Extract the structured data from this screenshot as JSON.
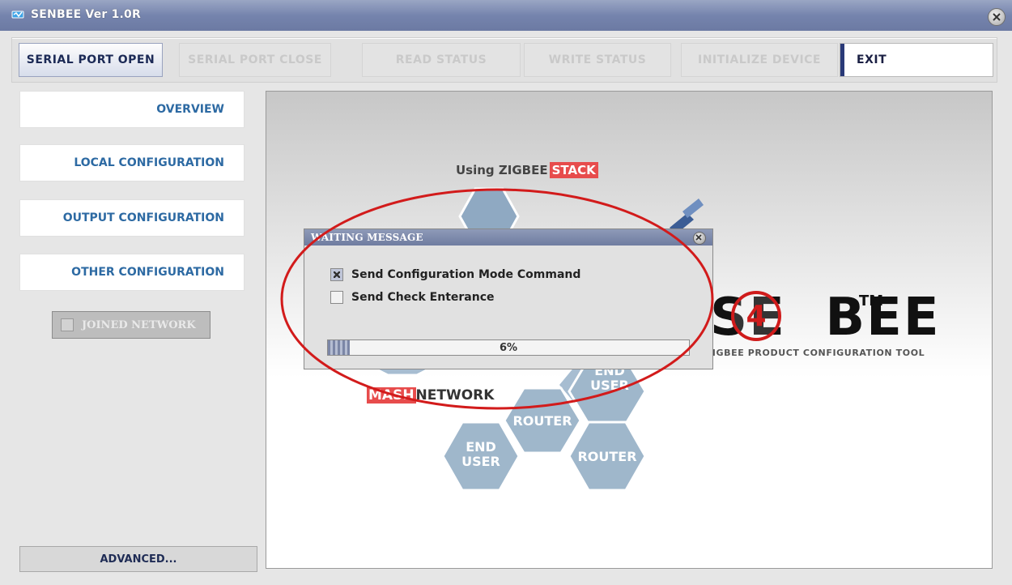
{
  "window": {
    "title": "SENBEE Ver 1.0R"
  },
  "toolbar": {
    "buttons": [
      {
        "label": "SERIAL PORT OPEN",
        "state": "active"
      },
      {
        "label": "SERIAL PORT CLOSE",
        "state": "disabled"
      },
      {
        "label": "READ STATUS",
        "state": "disabled"
      },
      {
        "label": "WRITE STATUS",
        "state": "disabled"
      },
      {
        "label": "INITIALIZE DEVICE",
        "state": "disabled"
      },
      {
        "label": "EXIT",
        "state": "normal"
      }
    ]
  },
  "sidebar": {
    "items": [
      {
        "label": "OVERVIEW"
      },
      {
        "label": "LOCAL CONFIGURATION"
      },
      {
        "label": "OUTPUT CONFIGURATION"
      },
      {
        "label": "OTHER CONFIGURATION"
      }
    ],
    "joined_network": {
      "label": "JOINED NETWORK",
      "checked": false
    },
    "advanced": {
      "label": "ADVANCED..."
    }
  },
  "overview": {
    "using_text": "Using ZIGBEE",
    "stack_text": "STACK",
    "mesh_highlight": "MASH",
    "network_text": "NETWORK",
    "hex_labels": {
      "end_user_1": "END\nUSER",
      "end_user_2": "END\nUSER",
      "router_1": "ROUTER",
      "router_2": "ROUTER"
    },
    "logo": {
      "text": "SE N BEE",
      "four": "4",
      "tm": "TM",
      "tagline": "H ZIGBEE PRODUCT CONFIGURATION TOOL"
    }
  },
  "dialog": {
    "title": "WAITING MESSAGE",
    "options": [
      {
        "label": "Send Configuration Mode Command",
        "checked": true
      },
      {
        "label": "Send Check Enterance",
        "checked": false
      }
    ],
    "progress": {
      "percent": 6,
      "label": "6%"
    }
  },
  "colors": {
    "title_bar": "#7584ad",
    "accent_blue": "#2d6aa3",
    "dark_navy": "#1c2a56",
    "hex_fill": "#9fb7cb",
    "highlight_red": "#e74c4c",
    "annotation_red": "#d21b1b"
  },
  "icons": {
    "app": "senbee-app-icon",
    "close": "close-icon",
    "dialog_close": "close-icon",
    "checkbox": "checkbox-icon"
  }
}
